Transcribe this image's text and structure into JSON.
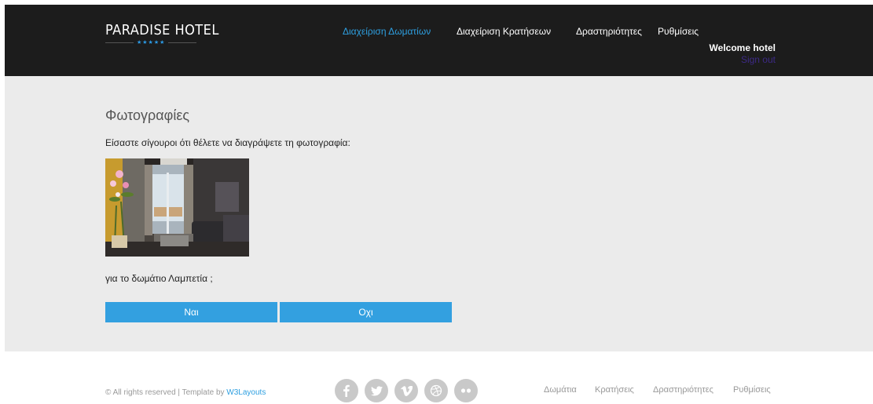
{
  "header": {
    "logo_text": "PARADISE HOTEL",
    "logo_stars": "★★★★★",
    "nav": [
      {
        "label": "Διαχείριση Δωματίων",
        "active": true
      },
      {
        "label": "Διαχείριση Κρατήσεων",
        "active": false
      },
      {
        "label": "Δραστηριότητες",
        "active": false
      },
      {
        "label": "Ρυθμίσεις",
        "active": false
      }
    ],
    "welcome": "Welcome hotel",
    "signout": "Sign out"
  },
  "main": {
    "title": "Φωτογραφίες",
    "confirm_text": "Είσαστε σίγουροι ότι θέλετε να διαγράψετε τη φωτογραφία:",
    "room_text": "για το δωμάτιο Λαμπετία ;",
    "yes_label": "Ναι",
    "no_label": "Οχι"
  },
  "footer": {
    "copyright_prefix": "© All rights reserved | Template by",
    "copyright_link": "W3Layouts",
    "social": [
      "facebook-icon",
      "twitter-icon",
      "vimeo-icon",
      "dribbble-icon",
      "flickr-icon"
    ],
    "links": [
      "Δωμάτια",
      "Κρατήσεις",
      "Δραστηριότητες",
      "Ρυθμίσεις"
    ]
  },
  "colors": {
    "accent": "#33a0e0",
    "header_bg": "#1c1c1c",
    "main_bg": "#ebebeb",
    "signout": "#3d2a86"
  }
}
